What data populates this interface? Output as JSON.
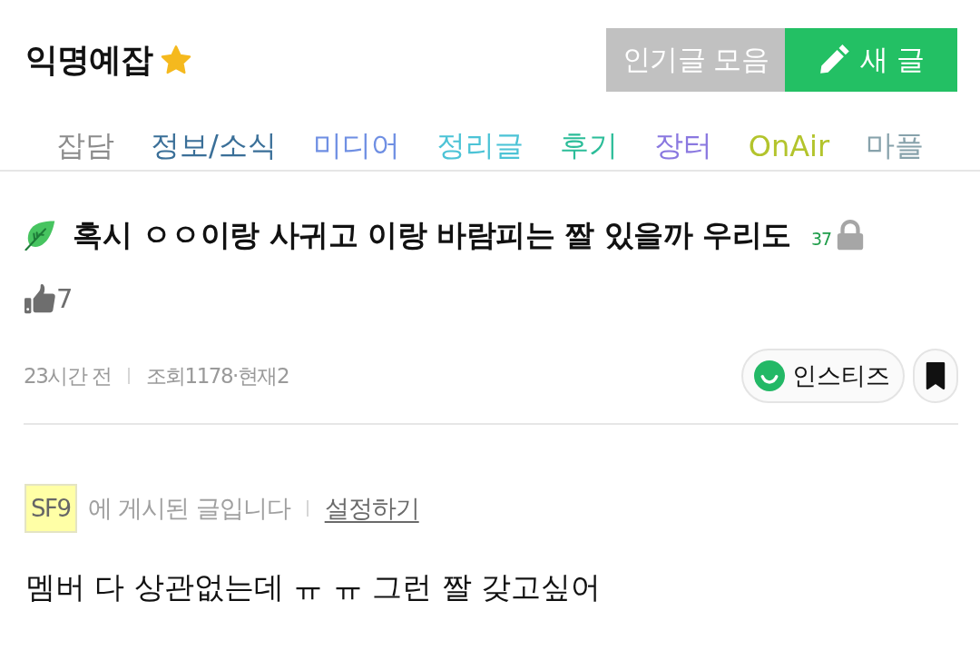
{
  "board": {
    "title": "익명예잡",
    "favorite": true,
    "buttons": [
      {
        "label": "인기글 모음",
        "kind": "popular"
      },
      {
        "label": "새 글",
        "kind": "write"
      }
    ]
  },
  "categories": [
    {
      "label": "잡담",
      "color": "#8c8c8c"
    },
    {
      "label": "정보/소식",
      "color": "#3a6f98"
    },
    {
      "label": "미디어",
      "color": "#6f8fe3"
    },
    {
      "label": "정리글",
      "color": "#4cc3d6"
    },
    {
      "label": "후기",
      "color": "#2cbd99"
    },
    {
      "label": "장터",
      "color": "#8a78e0"
    },
    {
      "label": "OnAir",
      "color": "#b3c42c"
    },
    {
      "label": "마플",
      "color": "#87a2ab"
    }
  ],
  "post": {
    "title": "혹시 ㅇㅇ이랑 사귀고 이랑 바람피는 짤 있을까 우리도",
    "comment_count": "37",
    "locked": true,
    "likes": "7",
    "time": "23시간 전",
    "stats": "조회1178·현재2",
    "source_button": "인스티즈",
    "bookmarked": true,
    "notice": {
      "tag": "SF9",
      "text": "에 게시된 글입니다",
      "link": "설정하기"
    },
    "body": "멤버 다 상관없는데 ㅠ ㅠ 그런 짤 갖고싶어"
  }
}
